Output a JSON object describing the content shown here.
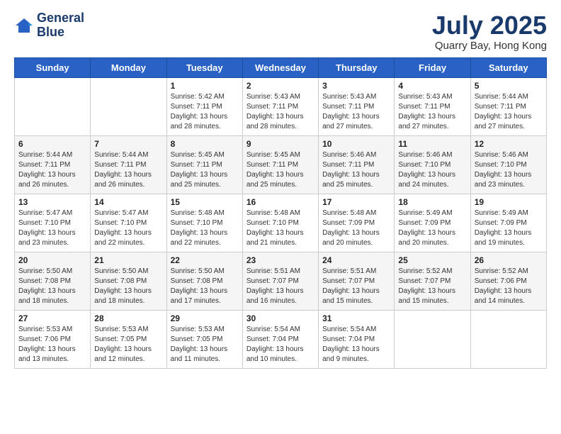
{
  "header": {
    "logo_line1": "General",
    "logo_line2": "Blue",
    "month_title": "July 2025",
    "location": "Quarry Bay, Hong Kong"
  },
  "weekdays": [
    "Sunday",
    "Monday",
    "Tuesday",
    "Wednesday",
    "Thursday",
    "Friday",
    "Saturday"
  ],
  "weeks": [
    [
      {
        "day": "",
        "detail": ""
      },
      {
        "day": "",
        "detail": ""
      },
      {
        "day": "1",
        "detail": "Sunrise: 5:42 AM\nSunset: 7:11 PM\nDaylight: 13 hours and 28 minutes."
      },
      {
        "day": "2",
        "detail": "Sunrise: 5:43 AM\nSunset: 7:11 PM\nDaylight: 13 hours and 28 minutes."
      },
      {
        "day": "3",
        "detail": "Sunrise: 5:43 AM\nSunset: 7:11 PM\nDaylight: 13 hours and 27 minutes."
      },
      {
        "day": "4",
        "detail": "Sunrise: 5:43 AM\nSunset: 7:11 PM\nDaylight: 13 hours and 27 minutes."
      },
      {
        "day": "5",
        "detail": "Sunrise: 5:44 AM\nSunset: 7:11 PM\nDaylight: 13 hours and 27 minutes."
      }
    ],
    [
      {
        "day": "6",
        "detail": "Sunrise: 5:44 AM\nSunset: 7:11 PM\nDaylight: 13 hours and 26 minutes."
      },
      {
        "day": "7",
        "detail": "Sunrise: 5:44 AM\nSunset: 7:11 PM\nDaylight: 13 hours and 26 minutes."
      },
      {
        "day": "8",
        "detail": "Sunrise: 5:45 AM\nSunset: 7:11 PM\nDaylight: 13 hours and 25 minutes."
      },
      {
        "day": "9",
        "detail": "Sunrise: 5:45 AM\nSunset: 7:11 PM\nDaylight: 13 hours and 25 minutes."
      },
      {
        "day": "10",
        "detail": "Sunrise: 5:46 AM\nSunset: 7:11 PM\nDaylight: 13 hours and 25 minutes."
      },
      {
        "day": "11",
        "detail": "Sunrise: 5:46 AM\nSunset: 7:10 PM\nDaylight: 13 hours and 24 minutes."
      },
      {
        "day": "12",
        "detail": "Sunrise: 5:46 AM\nSunset: 7:10 PM\nDaylight: 13 hours and 23 minutes."
      }
    ],
    [
      {
        "day": "13",
        "detail": "Sunrise: 5:47 AM\nSunset: 7:10 PM\nDaylight: 13 hours and 23 minutes."
      },
      {
        "day": "14",
        "detail": "Sunrise: 5:47 AM\nSunset: 7:10 PM\nDaylight: 13 hours and 22 minutes."
      },
      {
        "day": "15",
        "detail": "Sunrise: 5:48 AM\nSunset: 7:10 PM\nDaylight: 13 hours and 22 minutes."
      },
      {
        "day": "16",
        "detail": "Sunrise: 5:48 AM\nSunset: 7:10 PM\nDaylight: 13 hours and 21 minutes."
      },
      {
        "day": "17",
        "detail": "Sunrise: 5:48 AM\nSunset: 7:09 PM\nDaylight: 13 hours and 20 minutes."
      },
      {
        "day": "18",
        "detail": "Sunrise: 5:49 AM\nSunset: 7:09 PM\nDaylight: 13 hours and 20 minutes."
      },
      {
        "day": "19",
        "detail": "Sunrise: 5:49 AM\nSunset: 7:09 PM\nDaylight: 13 hours and 19 minutes."
      }
    ],
    [
      {
        "day": "20",
        "detail": "Sunrise: 5:50 AM\nSunset: 7:08 PM\nDaylight: 13 hours and 18 minutes."
      },
      {
        "day": "21",
        "detail": "Sunrise: 5:50 AM\nSunset: 7:08 PM\nDaylight: 13 hours and 18 minutes."
      },
      {
        "day": "22",
        "detail": "Sunrise: 5:50 AM\nSunset: 7:08 PM\nDaylight: 13 hours and 17 minutes."
      },
      {
        "day": "23",
        "detail": "Sunrise: 5:51 AM\nSunset: 7:07 PM\nDaylight: 13 hours and 16 minutes."
      },
      {
        "day": "24",
        "detail": "Sunrise: 5:51 AM\nSunset: 7:07 PM\nDaylight: 13 hours and 15 minutes."
      },
      {
        "day": "25",
        "detail": "Sunrise: 5:52 AM\nSunset: 7:07 PM\nDaylight: 13 hours and 15 minutes."
      },
      {
        "day": "26",
        "detail": "Sunrise: 5:52 AM\nSunset: 7:06 PM\nDaylight: 13 hours and 14 minutes."
      }
    ],
    [
      {
        "day": "27",
        "detail": "Sunrise: 5:53 AM\nSunset: 7:06 PM\nDaylight: 13 hours and 13 minutes."
      },
      {
        "day": "28",
        "detail": "Sunrise: 5:53 AM\nSunset: 7:05 PM\nDaylight: 13 hours and 12 minutes."
      },
      {
        "day": "29",
        "detail": "Sunrise: 5:53 AM\nSunset: 7:05 PM\nDaylight: 13 hours and 11 minutes."
      },
      {
        "day": "30",
        "detail": "Sunrise: 5:54 AM\nSunset: 7:04 PM\nDaylight: 13 hours and 10 minutes."
      },
      {
        "day": "31",
        "detail": "Sunrise: 5:54 AM\nSunset: 7:04 PM\nDaylight: 13 hours and 9 minutes."
      },
      {
        "day": "",
        "detail": ""
      },
      {
        "day": "",
        "detail": ""
      }
    ]
  ]
}
